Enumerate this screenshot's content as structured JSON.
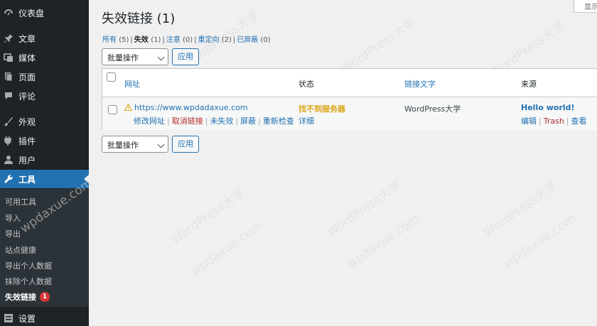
{
  "sidebar": {
    "items": [
      {
        "label": "仪表盘",
        "icon": "dashboard-icon"
      },
      {
        "label": "文章",
        "icon": "pin-icon"
      },
      {
        "label": "媒体",
        "icon": "media-icon"
      },
      {
        "label": "页面",
        "icon": "page-icon"
      },
      {
        "label": "评论",
        "icon": "comment-icon"
      },
      {
        "label": "外观",
        "icon": "brush-icon"
      },
      {
        "label": "插件",
        "icon": "plugin-icon"
      },
      {
        "label": "用户",
        "icon": "user-icon"
      },
      {
        "label": "工具",
        "icon": "wrench-icon"
      },
      {
        "label": "设置",
        "icon": "settings-icon"
      }
    ],
    "submenu": [
      {
        "label": "可用工具"
      },
      {
        "label": "导入"
      },
      {
        "label": "导出"
      },
      {
        "label": "站点健康"
      },
      {
        "label": "导出个人数据"
      },
      {
        "label": "抹除个人数据"
      },
      {
        "label": "失效链接",
        "badge": "1"
      }
    ],
    "active_color": "#2271b1"
  },
  "screen_options": "显示",
  "page": {
    "title": "失效链接 (1)"
  },
  "filters": [
    {
      "label": "所有",
      "count": "(5)"
    },
    {
      "label": "失效",
      "count": "(1)"
    },
    {
      "label": "注意",
      "count": "(0)"
    },
    {
      "label": "重定向",
      "count": "(2)"
    },
    {
      "label": "已屏蔽",
      "count": "(0)"
    }
  ],
  "bulk": {
    "select_label": "批量操作",
    "apply_label": "应用"
  },
  "table": {
    "columns": [
      "网址",
      "状态",
      "链接文字",
      "来源"
    ],
    "rows": [
      {
        "url": "https://www.wpdadaxue.com",
        "url_actions": [
          "修改网址",
          "取消链接",
          "未失效",
          "屏蔽",
          "重新检查"
        ],
        "status": "找不到服务器",
        "status_detail": "详细",
        "link_text": "WordPress大学",
        "source_title": "Hello world!",
        "source_actions": [
          "编辑",
          "Trash",
          "查看"
        ]
      }
    ]
  },
  "watermark": {
    "texts": [
      "WordPress大学",
      "wpdaxue.com"
    ]
  },
  "colors": {
    "sidebar_bg": "#1d2327",
    "link": "#2271b1",
    "warning": "#dba617",
    "danger": "#b32d2e"
  }
}
